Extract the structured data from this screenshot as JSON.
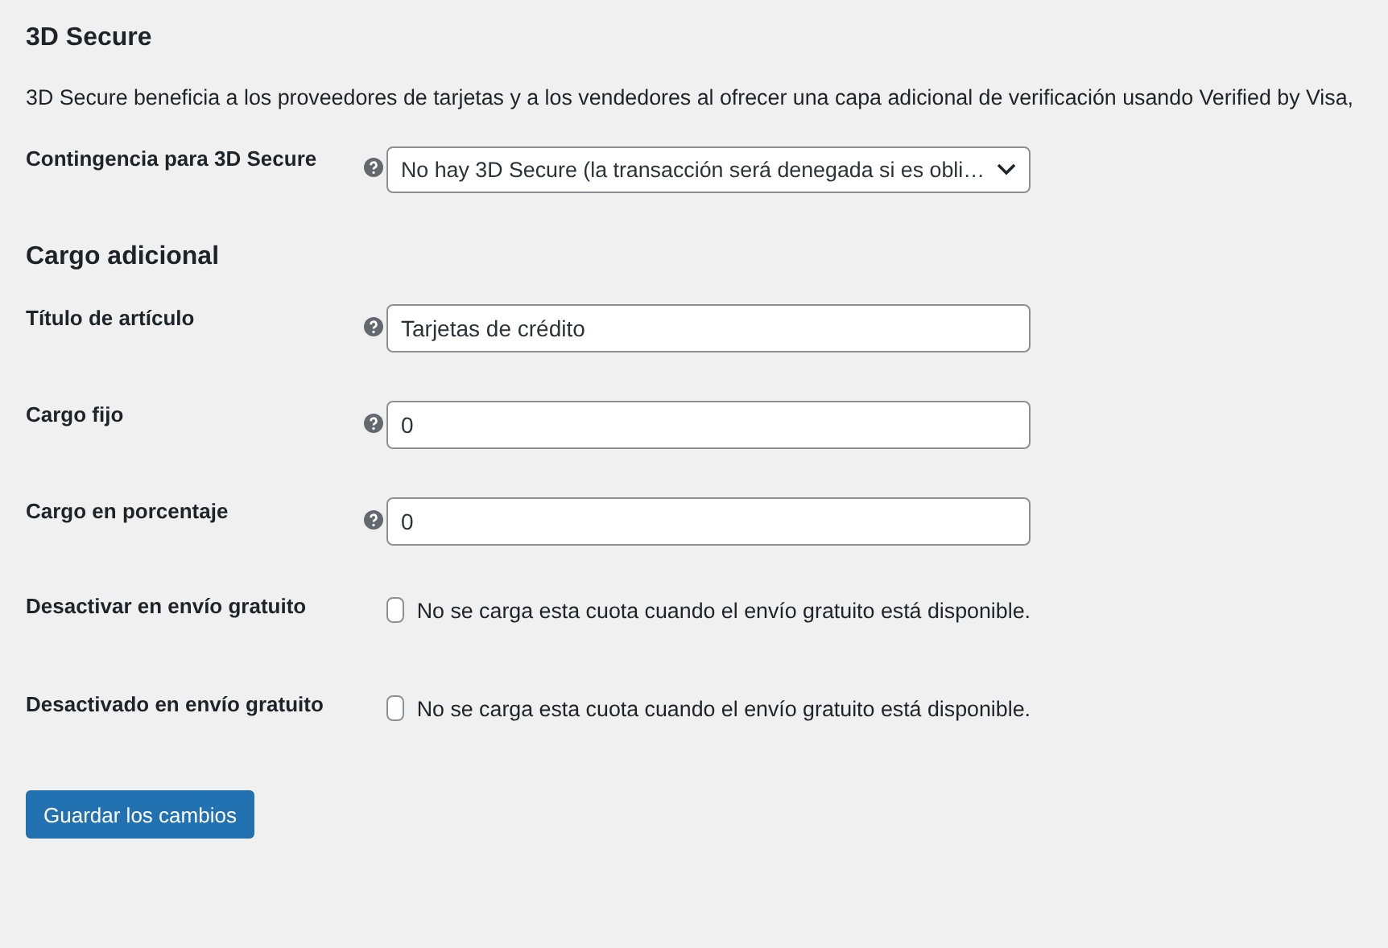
{
  "sections": [
    {
      "title": "3D Secure",
      "description": "3D Secure beneficia a los proveedores de tarjetas y a los vendedores al ofrecer una capa adicional de verificación usando Verified by Visa,",
      "fields": [
        {
          "kind": "select",
          "label": "Contingencia para 3D Secure",
          "help": true,
          "value": "No hay 3D Secure (la transacción será denegada si es obli…"
        }
      ]
    },
    {
      "title": "Cargo adicional",
      "fields": [
        {
          "kind": "text",
          "label": "Título de artículo",
          "help": true,
          "value": "Tarjetas de crédito"
        },
        {
          "kind": "text",
          "label": "Cargo fijo",
          "help": true,
          "value": "0"
        },
        {
          "kind": "text",
          "label": "Cargo en porcentaje",
          "help": true,
          "value": "0"
        },
        {
          "kind": "checkbox",
          "label": "Desactivar en envío gratuito",
          "help": false,
          "checked": false,
          "text": "No se carga esta cuota cuando el envío gratuito está disponible."
        },
        {
          "kind": "checkbox",
          "label": "Desactivado en envío gratuito",
          "help": false,
          "checked": false,
          "text": "No se carga esta cuota cuando el envío gratuito está disponible."
        }
      ]
    }
  ],
  "save_button": "Guardar los cambios"
}
